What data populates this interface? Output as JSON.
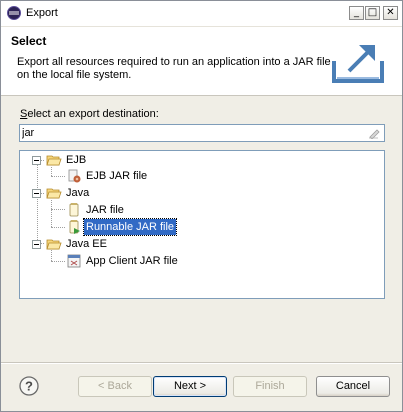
{
  "window": {
    "title": "Export",
    "controls": {
      "minimize": "_",
      "maximize": "□",
      "close": "✕"
    }
  },
  "header": {
    "title": "Select",
    "description": "Export all resources required to run an application into a JAR file on the local file system."
  },
  "destination": {
    "label_mnemonic": "S",
    "label_rest": "elect an export destination:",
    "filter_value": "jar",
    "filter_placeholder": ""
  },
  "tree": [
    {
      "label": "EJB",
      "icon": "folder-icon",
      "expanded": true,
      "children": [
        {
          "label": "EJB JAR file",
          "icon": "ejb-jar-icon",
          "selected": false
        }
      ]
    },
    {
      "label": "Java",
      "icon": "folder-icon",
      "expanded": true,
      "children": [
        {
          "label": "JAR file",
          "icon": "jar-file-icon",
          "selected": false
        },
        {
          "label": "Runnable JAR file",
          "icon": "runnable-jar-icon",
          "selected": true
        }
      ]
    },
    {
      "label": "Java EE",
      "icon": "folder-icon",
      "expanded": true,
      "children": [
        {
          "label": "App Client JAR file",
          "icon": "app-client-jar-icon",
          "selected": false
        }
      ]
    }
  ],
  "buttons": {
    "help": "?",
    "back": "< Back",
    "next": "Next >",
    "finish": "Finish",
    "cancel": "Cancel"
  },
  "colors": {
    "selection": "#316ac5",
    "folder": "#f2c55c",
    "banner_icon": "#4a7eb5"
  }
}
